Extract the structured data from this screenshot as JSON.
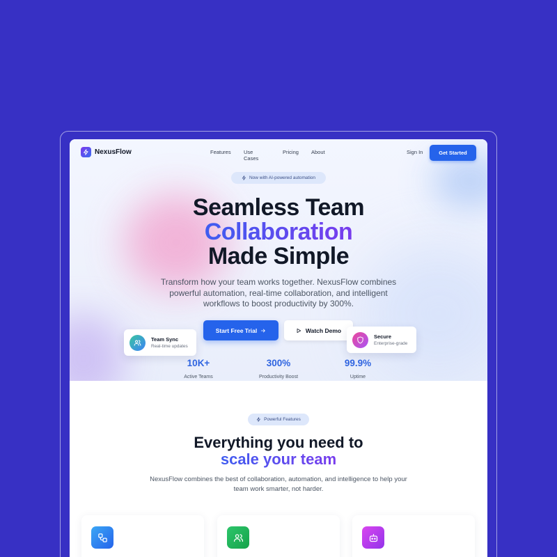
{
  "colors": {
    "background": "#3730c4",
    "accent": "#2563eb",
    "gradient_start": "#3b5ff0",
    "gradient_end": "#7c3aed"
  },
  "nav": {
    "brand": "NexusFlow",
    "links": [
      "Features",
      "Use Cases",
      "Pricing",
      "About"
    ],
    "sign_in": "Sign In",
    "cta": "Get Started"
  },
  "hero": {
    "badge": "Now with AI-powered automation",
    "title_line1": "Seamless Team",
    "title_line2": "Collaboration",
    "title_line3": "Made Simple",
    "subtitle": "Transform how your team works together. NexusFlow combines powerful automation, real-time collaboration, and intelligent workflows to boost productivity by 300%.",
    "primary_button": "Start Free Trial",
    "secondary_button": "Watch Demo",
    "float_left": {
      "title": "Team Sync",
      "subtitle": "Real-time updates",
      "icon": "users-icon"
    },
    "float_right": {
      "title": "Secure",
      "subtitle": "Enterprise-grade",
      "icon": "shield-icon"
    },
    "stats": [
      {
        "value": "10K+",
        "label": "Active Teams"
      },
      {
        "value": "300%",
        "label": "Productivity Boost"
      },
      {
        "value": "99.9%",
        "label": "Uptime"
      }
    ]
  },
  "features": {
    "badge": "Powerful Features",
    "title_line1": "Everything you need to",
    "title_line2": "scale your team",
    "subtitle": "NexusFlow combines the best of collaboration, automation, and intelligence to help your team work smarter, not harder.",
    "cards": [
      {
        "icon": "workflow-icon",
        "color": "#2f8cf0"
      },
      {
        "icon": "users-icon",
        "color": "#22b35e"
      },
      {
        "icon": "bot-icon",
        "color": "#b04fd8"
      }
    ]
  }
}
